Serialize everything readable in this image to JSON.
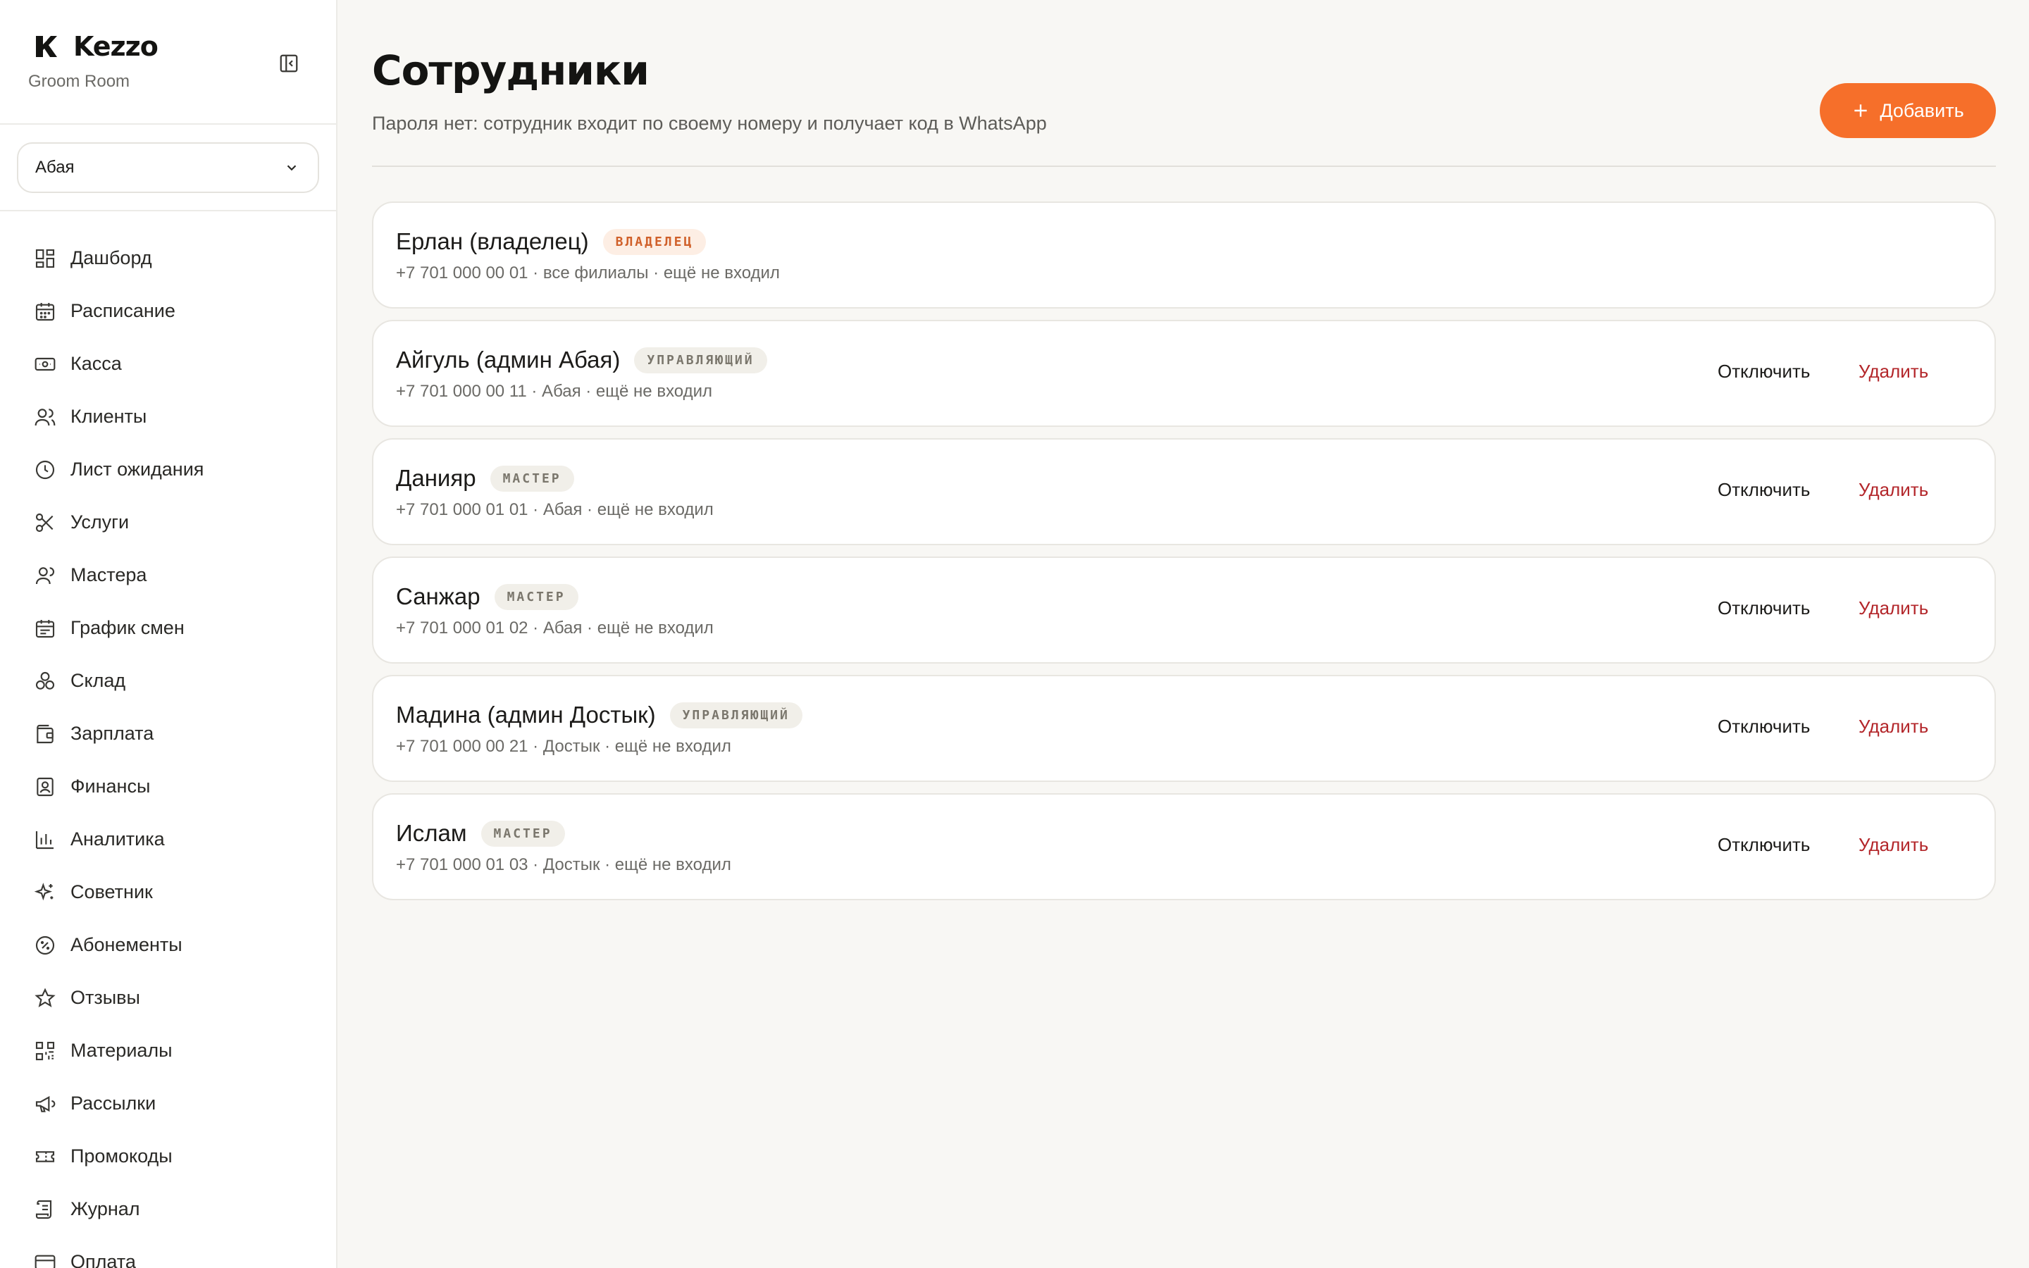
{
  "app": {
    "name": "Kezzo",
    "subtitle": "Groom Room"
  },
  "branch_select": {
    "value": "Абая"
  },
  "sidebar": {
    "items": [
      {
        "label": "Дашборд",
        "icon": "dashboard-icon"
      },
      {
        "label": "Расписание",
        "icon": "calendar-icon"
      },
      {
        "label": "Касса",
        "icon": "cash-icon"
      },
      {
        "label": "Клиенты",
        "icon": "users-icon"
      },
      {
        "label": "Лист ожидания",
        "icon": "clock-icon"
      },
      {
        "label": "Услуги",
        "icon": "scissors-icon"
      },
      {
        "label": "Мастера",
        "icon": "masters-icon"
      },
      {
        "label": "График смен",
        "icon": "schedule-icon"
      },
      {
        "label": "Склад",
        "icon": "boxes-icon"
      },
      {
        "label": "Зарплата",
        "icon": "wallet-icon"
      },
      {
        "label": "Финансы",
        "icon": "finance-icon"
      },
      {
        "label": "Аналитика",
        "icon": "chart-icon"
      },
      {
        "label": "Советник",
        "icon": "sparkles-icon"
      },
      {
        "label": "Абонементы",
        "icon": "badge-percent-icon"
      },
      {
        "label": "Отзывы",
        "icon": "star-icon"
      },
      {
        "label": "Материалы",
        "icon": "qr-icon"
      },
      {
        "label": "Рассылки",
        "icon": "megaphone-icon"
      },
      {
        "label": "Промокоды",
        "icon": "ticket-icon"
      },
      {
        "label": "Журнал",
        "icon": "scroll-icon"
      },
      {
        "label": "Оплата",
        "icon": "card-icon"
      }
    ]
  },
  "page": {
    "title": "Сотрудники",
    "subtitle": "Пароля нет: сотрудник входит по своему номеру и получает код в WhatsApp",
    "add_label": "Добавить"
  },
  "actions": {
    "disable_label": "Отключить",
    "delete_label": "Удалить"
  },
  "employees": [
    {
      "name": "Ерлан (владелец)",
      "role": "ВЛАДЕЛЕЦ",
      "meta": "+7 701 000 00 01 · все филиалы · ещё не входил"
    },
    {
      "name": "Айгуль (админ Абая)",
      "role": "УПРАВЛЯЮЩИЙ",
      "meta": "+7 701 000 00 11 · Абая · ещё не входил"
    },
    {
      "name": "Данияр",
      "role": "МАСТЕР",
      "meta": "+7 701 000 01 01 · Абая · ещё не входил"
    },
    {
      "name": "Санжар",
      "role": "МАСТЕР",
      "meta": "+7 701 000 01 02 · Абая · ещё не входил"
    },
    {
      "name": "Мадина (админ Достык)",
      "role": "УПРАВЛЯЮЩИЙ",
      "meta": "+7 701 000 00 21 · Достык · ещё не входил"
    },
    {
      "name": "Ислам",
      "role": "МАСТЕР",
      "meta": "+7 701 000 01 03 · Достык · ещё не входил"
    }
  ],
  "colors": {
    "accent": "#f66f2a",
    "danger": "#b3262a",
    "owner_badge_text": "#d0602a"
  }
}
